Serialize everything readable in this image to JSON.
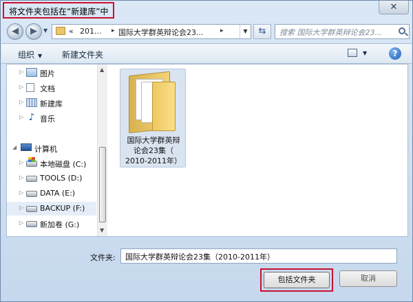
{
  "window": {
    "title": "将文件夹包括在“新建库”中",
    "close_glyph": "✕"
  },
  "address_bar": {
    "overflow_glyph": "«",
    "segments": [
      "201...",
      "国际大学群英辩论会23..."
    ],
    "separator": "▸"
  },
  "search": {
    "placeholder": "搜索 国际大学群英辩论会23..."
  },
  "toolbar": {
    "organize_label": "组织",
    "new_folder_label": "新建文件夹",
    "help_glyph": "?"
  },
  "nav_pane": {
    "items": [
      {
        "label": "图片",
        "icon": "pictures-icon"
      },
      {
        "label": "文档",
        "icon": "documents-icon"
      },
      {
        "label": "新建库",
        "icon": "library-icon"
      },
      {
        "label": "音乐",
        "icon": "music-icon"
      },
      {
        "label": "计算机",
        "icon": "computer-icon"
      },
      {
        "label": "本地磁盘 (C:)",
        "icon": "system-drive-icon"
      },
      {
        "label": "TOOLS (D:)",
        "icon": "drive-icon"
      },
      {
        "label": "DATA (E:)",
        "icon": "drive-icon"
      },
      {
        "label": "BACKUP (F:)",
        "icon": "drive-icon",
        "selected": true
      },
      {
        "label": "新加卷 (G:)",
        "icon": "drive-icon"
      }
    ]
  },
  "content": {
    "folders": [
      {
        "name": "国际大学群英辩论会23集（2010-2011年）",
        "line1": "国际大学群英辩",
        "line2": "论会23集（",
        "line3": "2010-2011年）"
      }
    ]
  },
  "footer": {
    "folder_label": "文件夹:",
    "folder_value": "国际大学群英辩论会23集（2010-2011年）",
    "include_button": "包括文件夹",
    "cancel_button": "取消"
  },
  "colors": {
    "highlight_border": "#c8102e",
    "selection": "#e5eef8"
  }
}
